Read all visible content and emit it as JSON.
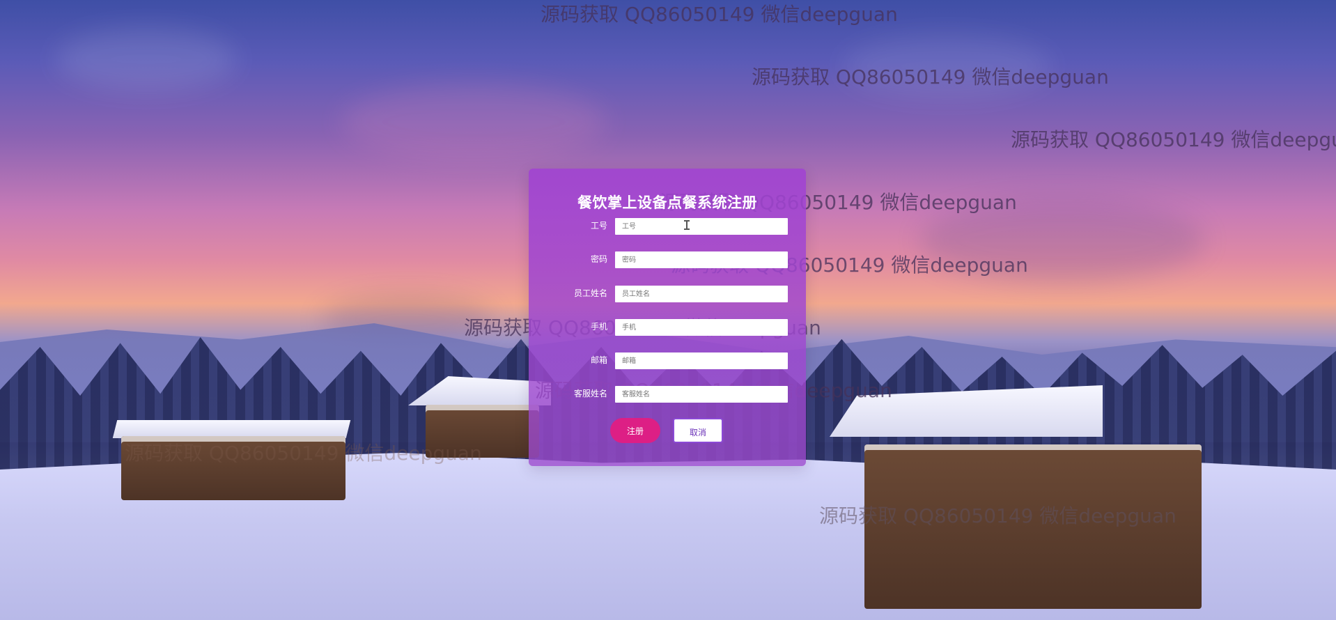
{
  "registration": {
    "title": "餐饮掌上设备点餐系统注册",
    "fields": [
      {
        "label": "工号",
        "placeholder": "工号"
      },
      {
        "label": "密码",
        "placeholder": "密码"
      },
      {
        "label": "员工姓名",
        "placeholder": "员工姓名"
      },
      {
        "label": "手机",
        "placeholder": "手机"
      },
      {
        "label": "邮箱",
        "placeholder": "邮箱"
      },
      {
        "label": "客服姓名",
        "placeholder": "客服姓名"
      }
    ],
    "buttons": {
      "register": "注册",
      "cancel": "取消"
    }
  },
  "watermark_text": "源码获取 QQ86050149 微信deepguan"
}
